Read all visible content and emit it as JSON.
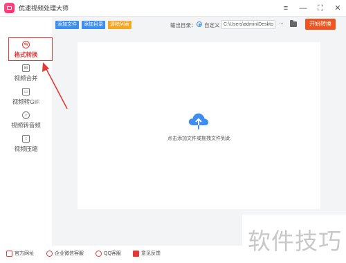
{
  "window": {
    "title": "优速视频处理大师",
    "controls": [
      "≡",
      "—",
      "⛶",
      "✕"
    ]
  },
  "sidebar": {
    "items": [
      {
        "label": "格式转换",
        "icon": "convert-icon",
        "active": true
      },
      {
        "label": "视频合并",
        "icon": "merge-icon",
        "active": false
      },
      {
        "label": "视频转GIF",
        "icon": "gif-icon",
        "active": false
      },
      {
        "label": "视频转音频",
        "icon": "audio-icon",
        "active": false
      },
      {
        "label": "视频压缩",
        "icon": "compress-icon",
        "active": false
      }
    ]
  },
  "toolbar": {
    "add_file": "添加文件",
    "add_folder": "添加目录",
    "clear_list": "清除列表",
    "output_label": "输出目录：",
    "custom_option": "自定义",
    "output_path": "C:\\Users\\admin\\Deskto",
    "more": "···",
    "start": "开始转换"
  },
  "main": {
    "drop_hint": "点击添加文件或拖拽文件到此"
  },
  "footer": {
    "items": [
      {
        "label": "官方网址",
        "icon": "website-icon"
      },
      {
        "label": "企业微信客服",
        "icon": "wechat-service-icon"
      },
      {
        "label": "QQ客服",
        "icon": "qq-icon"
      },
      {
        "label": "意见反馈",
        "icon": "feedback-icon"
      }
    ]
  },
  "watermark": {
    "text": "软件技巧"
  },
  "colors": {
    "accent_red": "#e53935",
    "button_blue": "#3d8ef0",
    "button_orange": "#f5a623",
    "start_orange": "#f0541e",
    "cloud_blue": "#3d8ef0"
  }
}
